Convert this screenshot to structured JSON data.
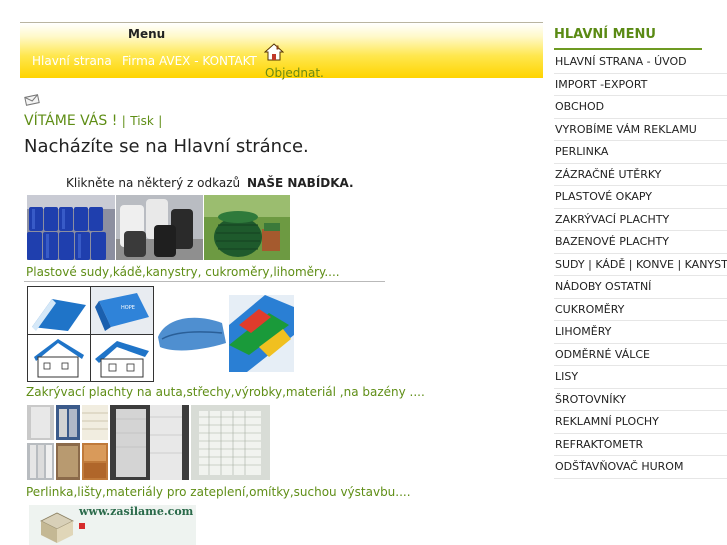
{
  "topmenu": {
    "title": "Menu",
    "links": [
      "Hlavní strana",
      "Firma AVEX - KONTAKT"
    ],
    "order": "Objednat."
  },
  "content": {
    "welcome": "VÍTÁME VÁS !",
    "separator": "|",
    "print": "Tisk",
    "separator_end": "|",
    "page_title": "Nacházíte se na Hlavní stránce.",
    "click_hint": "Klikněte na  některý z odkazů",
    "offer": "NAŠE NABÍDKA.",
    "categories": [
      "Plastové sudy,kádě,kanystry, cukroměry,lihoměry....",
      "Zakrývací plachty na auta,střechy,výrobky,materiál ,na bazény ....",
      "Perlinka,lišty,materiály pro zateplení,omítky,suchou výstavbu...."
    ],
    "banner_text": "www.zasilame.com"
  },
  "sidemenu": {
    "title": "HLAVNÍ MENU",
    "items": [
      "HLAVNÍ STRANA - ÚVOD",
      "IMPORT -EXPORT",
      "OBCHOD",
      "VYROBÍME VÁM REKLAMU",
      "PERLINKA",
      "ZÁZRAČNÉ UTĚRKY",
      "PLASTOVÉ OKAPY",
      "ZAKRÝVACÍ PLACHTY",
      "BAZENOVÉ PLACHTY",
      "SUDY | KÁDĚ | KONVE | KANYSTRY",
      "NÁDOBY OSTATNÍ",
      "CUKROMĚRY",
      "LIHOMĚRY",
      "ODMĚRNÉ VÁLCE",
      "LISY",
      "ŠROTOVNÍKY",
      "REKLAMNÍ PLOCHY",
      "REFRAKTOMETR",
      "ODŠŤAVŇOVAČ HUROM"
    ]
  },
  "colors": {
    "accent_green": "#5f8e16",
    "menu_yellow": "#ffd400"
  }
}
